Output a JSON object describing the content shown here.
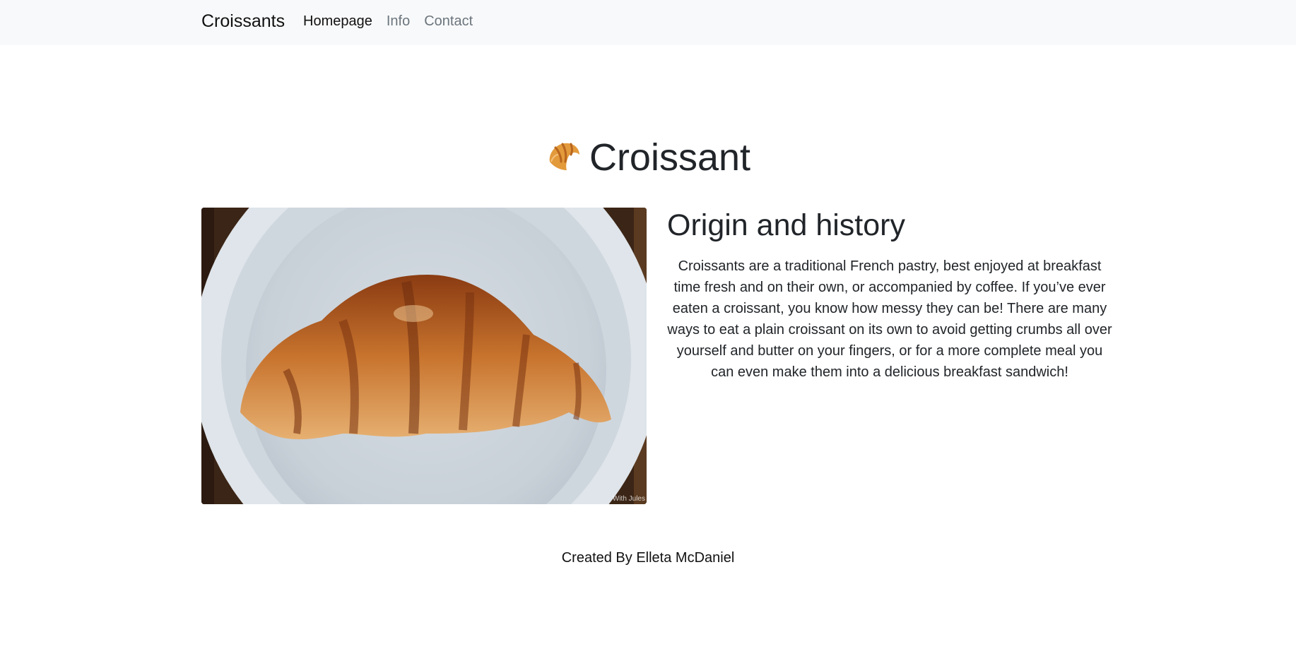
{
  "navbar": {
    "brand": "Croissants",
    "links": [
      {
        "label": "Homepage",
        "active": true
      },
      {
        "label": "Info",
        "active": false
      },
      {
        "label": "Contact",
        "active": false
      }
    ]
  },
  "hero": {
    "icon": "croissant-emoji-icon",
    "title": "Croissant"
  },
  "photo": {
    "subject": "croissant-on-white-plate",
    "watermark": "With Jules"
  },
  "section": {
    "title": "Origin and history",
    "text": "Croissants are a traditional French pastry, best enjoyed at breakfast time fresh and on their own, or accompanied by coffee. If you’ve ever eaten a croissant, you know how messy they can be! There are many ways to eat a plain croissant on its own to avoid getting crumbs all over yourself and butter on your fingers, or for a more complete meal you can even make them into a delicious breakfast sandwich!"
  },
  "footer": {
    "text": "Created By Elleta McDaniel"
  }
}
